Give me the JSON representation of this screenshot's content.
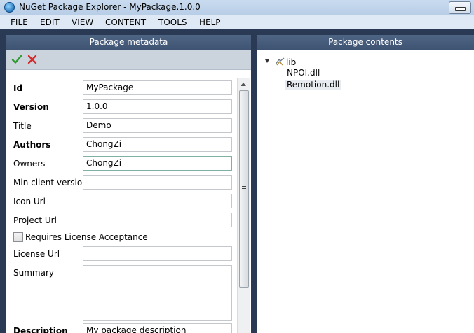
{
  "window": {
    "title": "NuGet Package Explorer - MyPackage.1.0.0"
  },
  "menu": {
    "items": [
      {
        "label": "FILE"
      },
      {
        "label": "EDIT"
      },
      {
        "label": "VIEW"
      },
      {
        "label": "CONTENT"
      },
      {
        "label": "TOOLS"
      },
      {
        "label": "HELP"
      }
    ]
  },
  "metadata_panel": {
    "header": "Package metadata",
    "fields": {
      "id": {
        "label": "Id",
        "value": ""
      },
      "id_value": "MyPackage",
      "version": {
        "label": "Version"
      },
      "version_value": "1.0.0",
      "title": {
        "label": "Title"
      },
      "title_value": "Demo",
      "authors": {
        "label": "Authors"
      },
      "authors_value": "ChongZi",
      "owners": {
        "label": "Owners"
      },
      "owners_value": "ChongZi",
      "min_client": {
        "label": "Min client version"
      },
      "min_client_value": "",
      "icon_url": {
        "label": "Icon Url"
      },
      "icon_url_value": "",
      "project_url": {
        "label": "Project Url"
      },
      "project_url_value": "",
      "license_acceptance": {
        "label": "Requires License Acceptance",
        "checked": false
      },
      "license_url": {
        "label": "License Url"
      },
      "license_url_value": "",
      "summary": {
        "label": "Summary"
      },
      "summary_value": "",
      "description": {
        "label": "Description"
      },
      "description_value": "My package description"
    }
  },
  "contents_panel": {
    "header": "Package contents",
    "tree": {
      "root": "lib",
      "children": [
        "NPOI.dll",
        "Remotion.dll"
      ]
    }
  },
  "colors": {
    "header_bg": "#44597a",
    "accept_icon": "#2e9a2e",
    "cancel_icon": "#d62b2b"
  }
}
